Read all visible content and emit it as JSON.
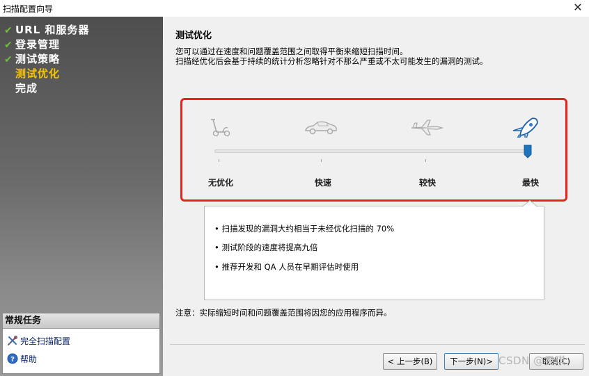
{
  "window": {
    "title": "扫描配置向导",
    "close_glyph": "✕"
  },
  "sidebar": {
    "steps": [
      {
        "label": "URL 和服务器",
        "done": true
      },
      {
        "label": "登录管理",
        "done": true
      },
      {
        "label": "测试策略",
        "done": true
      },
      {
        "label": "测试优化",
        "done": false,
        "active": true
      },
      {
        "label": "完成",
        "done": false
      }
    ],
    "check_glyph": "✔",
    "tasks": {
      "title": "常规任务",
      "items": [
        {
          "label": "完全扫描配置",
          "icon": "tools-icon"
        },
        {
          "label": "帮助",
          "icon": "help-icon"
        }
      ]
    }
  },
  "main": {
    "heading": "测试优化",
    "description": [
      "您可以通过在速度和问题覆盖范围之间取得平衡来缩短扫描时间。",
      "扫描经优化后会基于持续的统计分析忽略针对不那么严重或不太可能发生的漏洞的测试。"
    ],
    "slider": {
      "levels": [
        {
          "label": "无优化",
          "icon": "scooter-icon"
        },
        {
          "label": "快速",
          "icon": "car-icon"
        },
        {
          "label": "较快",
          "icon": "jet-icon"
        },
        {
          "label": "最快",
          "icon": "rocket-icon"
        }
      ],
      "selected_index": 3,
      "accent_color": "#1e73be",
      "highlight_color": "#e8231c"
    },
    "info_bullets": [
      "• 扫描发现的漏洞大约相当于未经优化扫描的 70%",
      "• 测试阶段的速度将提高九倍",
      "• 推荐开发和 QA 人员在早期评估时使用"
    ],
    "note": "注意：实际缩短时间和问题覆盖范围将因您的应用程序而异。"
  },
  "buttons": {
    "back": "< 上一步(B)",
    "next": "下一步(N)>",
    "cancel": "取消(C)"
  },
  "watermark": "CSDN @雯琪."
}
